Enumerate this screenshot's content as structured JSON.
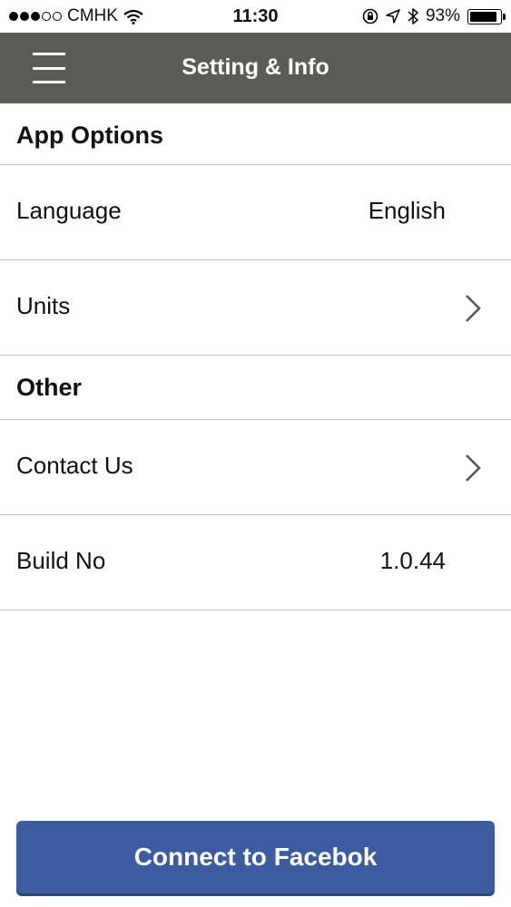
{
  "status_bar": {
    "carrier": "CMHK",
    "time": "11:30",
    "battery_percent": "93%",
    "battery_level": 0.93,
    "signal_bars": 3,
    "signal_total": 5
  },
  "nav": {
    "title": "Setting & Info",
    "menu_icon": "hamburger-menu-icon"
  },
  "sections": {
    "app_options": {
      "header": "App Options",
      "language_label": "Language",
      "language_value": "English",
      "units_label": "Units"
    },
    "other": {
      "header": "Other",
      "contact_label": "Contact Us",
      "build_label": "Build No",
      "build_value": "1.0.44"
    }
  },
  "facebook_button": {
    "label": "Connect to Facebok",
    "color": "#3d5ba0"
  },
  "colors": {
    "navbar": "#5b5b58",
    "divider": "#bfbfbf"
  }
}
